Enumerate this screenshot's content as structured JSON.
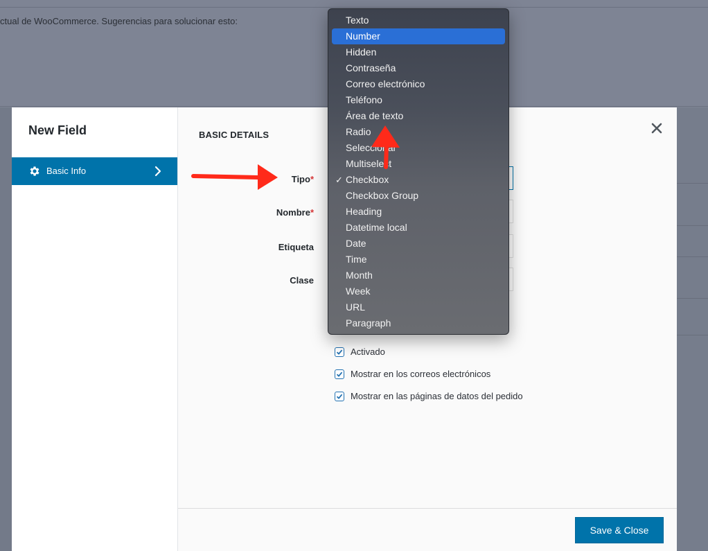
{
  "background": {
    "notice_text": "ctual de WooCommerce. Sugerencias para solucionar esto:"
  },
  "modal": {
    "title": "New Field",
    "sidebar": {
      "items": [
        {
          "label": "Basic Info",
          "icon": "gear-icon",
          "active": true
        }
      ]
    },
    "section_title": "BASIC DETAILS",
    "close_icon": "close-icon",
    "fields": [
      {
        "label": "Tipo",
        "required": "*"
      },
      {
        "label": "Nombre",
        "required": "*"
      },
      {
        "label": "Etiqueta"
      },
      {
        "label": "Clase"
      }
    ],
    "checkboxes": [
      {
        "label": "Activado",
        "checked": true
      },
      {
        "label": "Mostrar en los correos electrónicos",
        "checked": true
      },
      {
        "label": "Mostrar en las páginas de datos del pedido",
        "checked": true
      }
    ],
    "footer": {
      "save_label": "Save & Close"
    }
  },
  "dropdown": {
    "highlighted": "Number",
    "selected": "Checkbox",
    "check_glyph": "✓",
    "options": [
      "Texto",
      "Number",
      "Hidden",
      "Contraseña",
      "Correo electrónico",
      "Teléfono",
      "Área de texto",
      "Radio",
      "Seleccionar",
      "Multiselect",
      "Checkbox",
      "Checkbox Group",
      "Heading",
      "Datetime local",
      "Date",
      "Time",
      "Month",
      "Week",
      "URL",
      "Paragraph"
    ]
  },
  "colors": {
    "primary": "#0073aa",
    "annotation": "#ff2a1a",
    "menu_highlight": "#2a6fd6"
  }
}
